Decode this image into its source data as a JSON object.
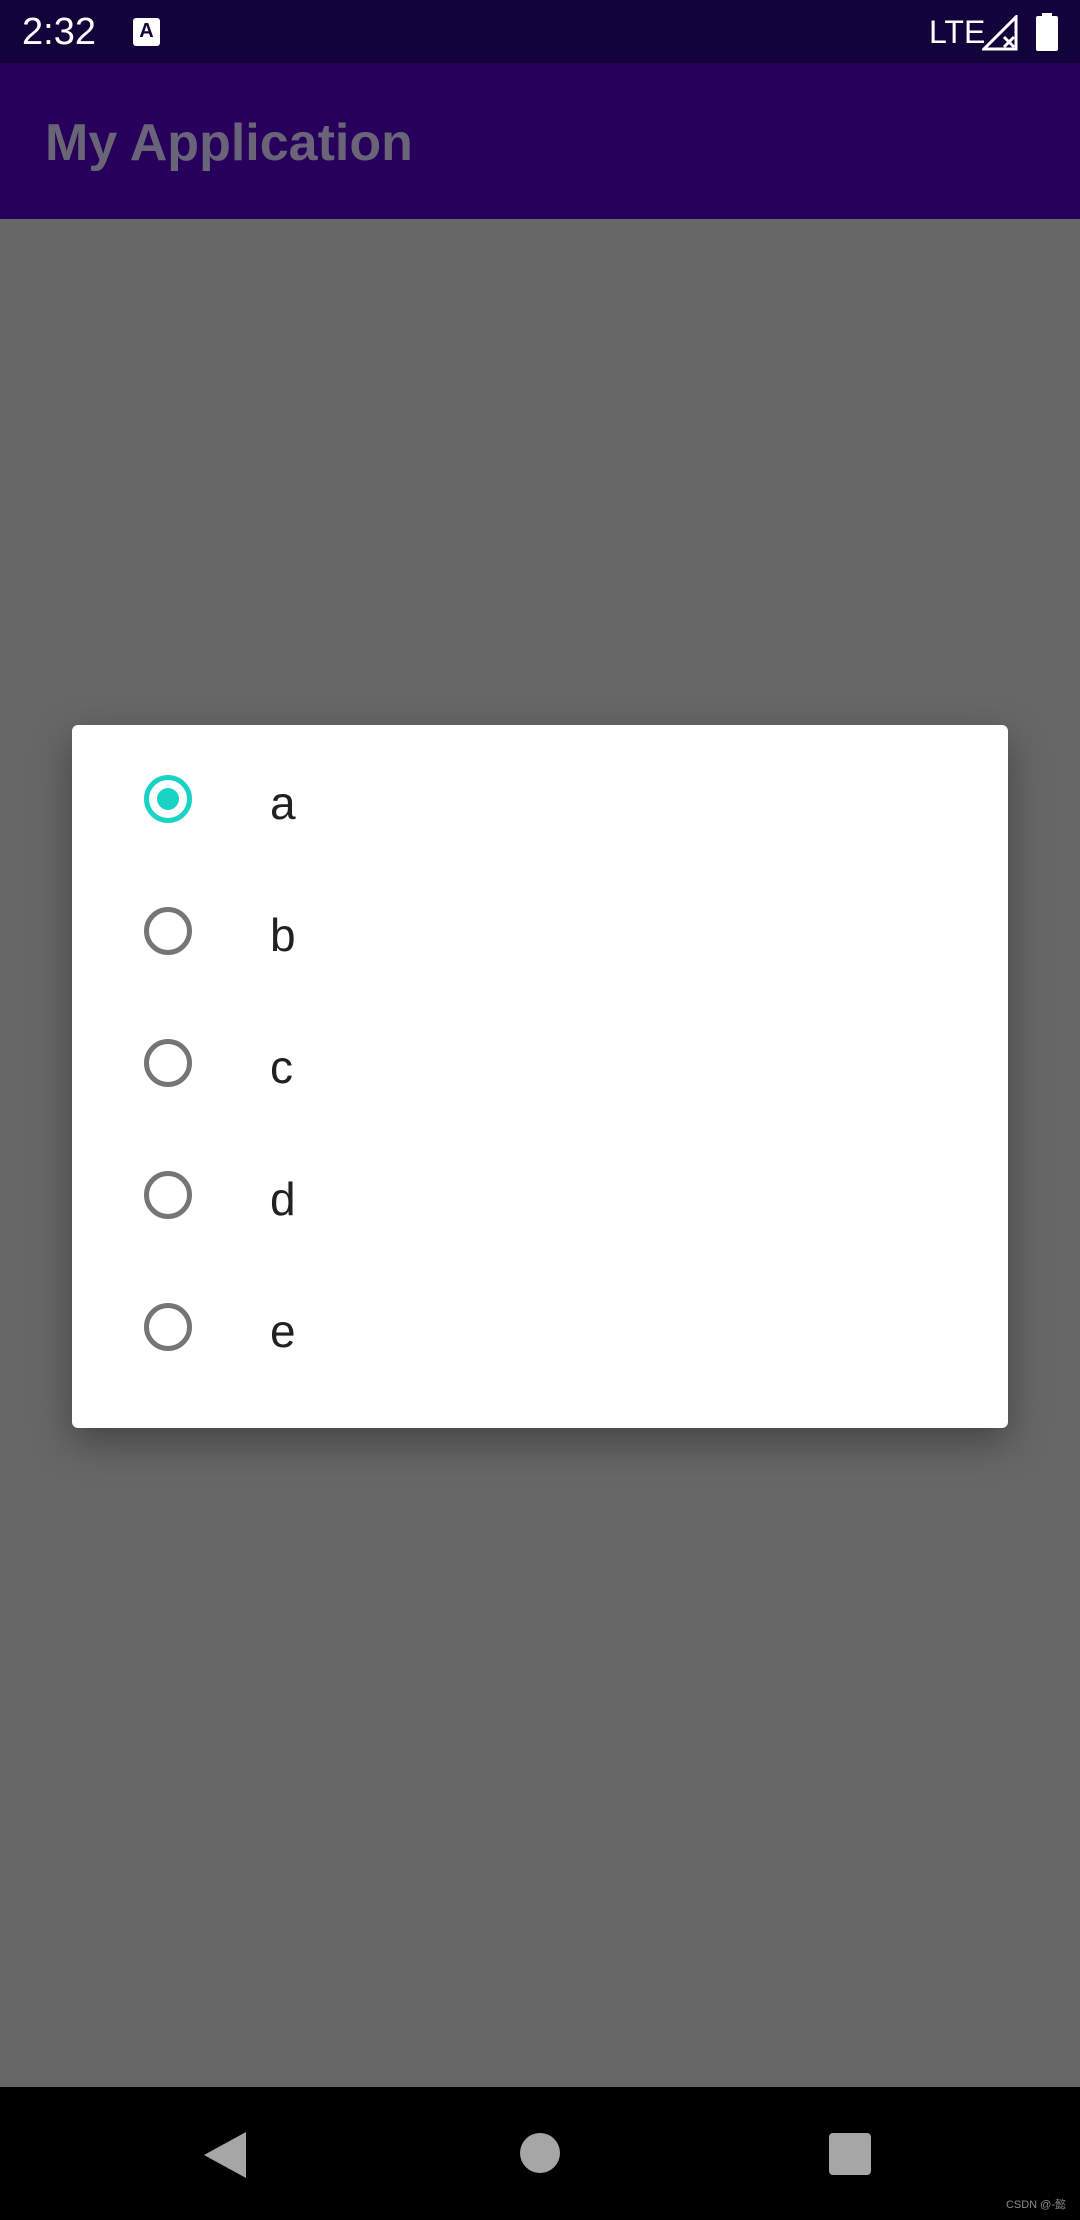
{
  "status_bar": {
    "time": "2:32",
    "app_icon_glyph": "A",
    "network": "LTE"
  },
  "app_bar": {
    "title": "My Application"
  },
  "dialog": {
    "options": [
      {
        "label": "a",
        "checked": true
      },
      {
        "label": "b",
        "checked": false
      },
      {
        "label": "c",
        "checked": false
      },
      {
        "label": "d",
        "checked": false
      },
      {
        "label": "e",
        "checked": false
      }
    ]
  },
  "watermark": "CSDN @-懿",
  "colors": {
    "status_bar": "#13033b",
    "app_bar": "#27005c",
    "scrim": "#676767",
    "radio_accent": "#1ad3c5",
    "radio_unchecked": "#757575"
  },
  "icons": {
    "status": [
      "app-notification-icon",
      "signal-no-service-icon",
      "battery-icon"
    ],
    "navigation": [
      "back-icon",
      "home-icon",
      "recents-icon"
    ]
  }
}
